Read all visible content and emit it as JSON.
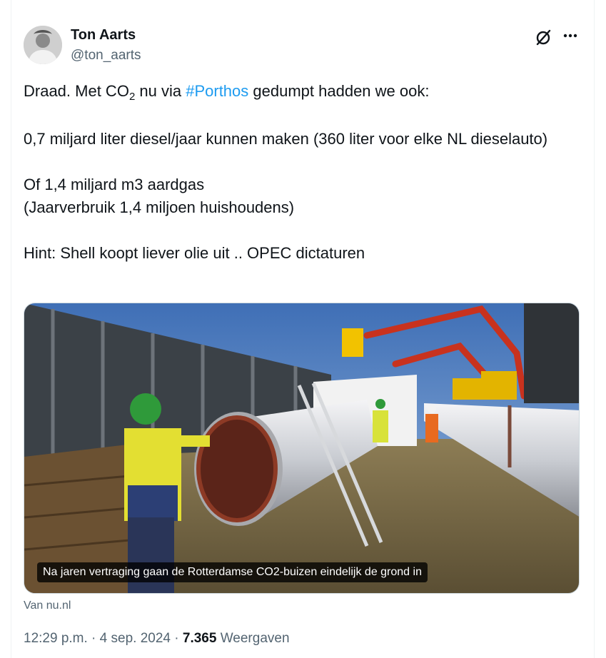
{
  "author": {
    "name": "Ton Aarts",
    "handle": "@ton_aarts"
  },
  "icons": {
    "grok": "grok-slash-icon",
    "more": "more-dots-icon"
  },
  "tweet": {
    "line1_prefix": "Draad. Met CO",
    "line1_sub": "2",
    "line1_mid": " nu via ",
    "line1_hashtag": "#Porthos",
    "line1_suffix": " gedumpt hadden we ook:",
    "para2": "0,7 miljard liter diesel/jaar kunnen maken (360 liter voor elke NL dieselauto)",
    "para3_line1": "Of 1,4 miljard m3 aardgas",
    "para3_line2": "(Jaarverbruik 1,4 miljoen huishoudens)",
    "para4": "Hint: Shell koopt liever olie uit .. OPEC dictaturen"
  },
  "card": {
    "caption": "Na jaren vertraging gaan de Rotterdamse CO2-buizen eindelijk de grond in",
    "source": "Van nu.nl"
  },
  "footer": {
    "time": "12:29 p.m.",
    "sep1": " · ",
    "date": "4 sep. 2024",
    "sep2": " · ",
    "views_count": "7.365",
    "views_label": " Weergaven"
  }
}
